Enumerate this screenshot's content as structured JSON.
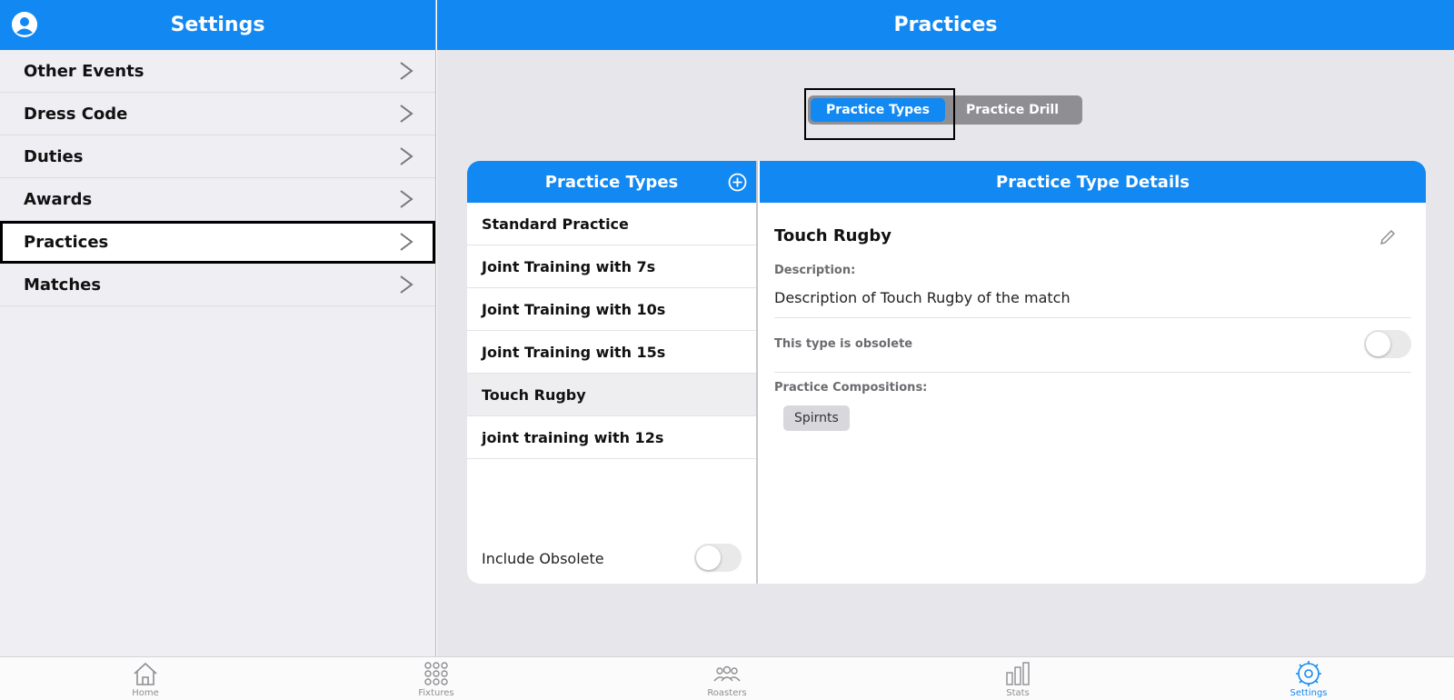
{
  "sidebar": {
    "title": "Settings",
    "items": [
      {
        "label": "Other Events"
      },
      {
        "label": "Dress Code"
      },
      {
        "label": "Duties"
      },
      {
        "label": "Awards"
      },
      {
        "label": "Practices",
        "selected": true
      },
      {
        "label": "Matches"
      }
    ]
  },
  "main": {
    "title": "Practices",
    "segments": [
      {
        "label": "Practice Types",
        "active": true
      },
      {
        "label": "Practice Drill",
        "active": false
      }
    ],
    "list": {
      "title": "Practice Types",
      "items": [
        {
          "label": "Standard Practice"
        },
        {
          "label": "Joint Training with 7s"
        },
        {
          "label": "Joint Training with 10s"
        },
        {
          "label": "Joint Training with 15s"
        },
        {
          "label": "Touch Rugby",
          "selected": true
        },
        {
          "label": "joint training with 12s"
        }
      ],
      "include_obsolete_label": "Include Obsolete",
      "include_obsolete_on": false
    },
    "detail": {
      "header": "Practice Type Details",
      "name": "Touch Rugby",
      "description_label": "Description:",
      "description": "Description of Touch Rugby of the match",
      "obsolete_label": "This type is obsolete",
      "obsolete_on": false,
      "compositions_label": "Practice Compositions:",
      "compositions": [
        "Spirnts"
      ]
    }
  },
  "tabbar": {
    "tabs": [
      {
        "label": "Home",
        "icon": "home-icon"
      },
      {
        "label": "Fixtures",
        "icon": "grid-dots-icon"
      },
      {
        "label": "Roasters",
        "icon": "people-icon"
      },
      {
        "label": "Stats",
        "icon": "bar-chart-icon"
      },
      {
        "label": "Settings",
        "icon": "gear-icon",
        "active": true
      }
    ]
  },
  "colors": {
    "accent": "#1188f2",
    "sidebar_bg": "#eeeef3",
    "main_bg": "#e6e6eb",
    "segment_inactive": "#8e8e93"
  }
}
